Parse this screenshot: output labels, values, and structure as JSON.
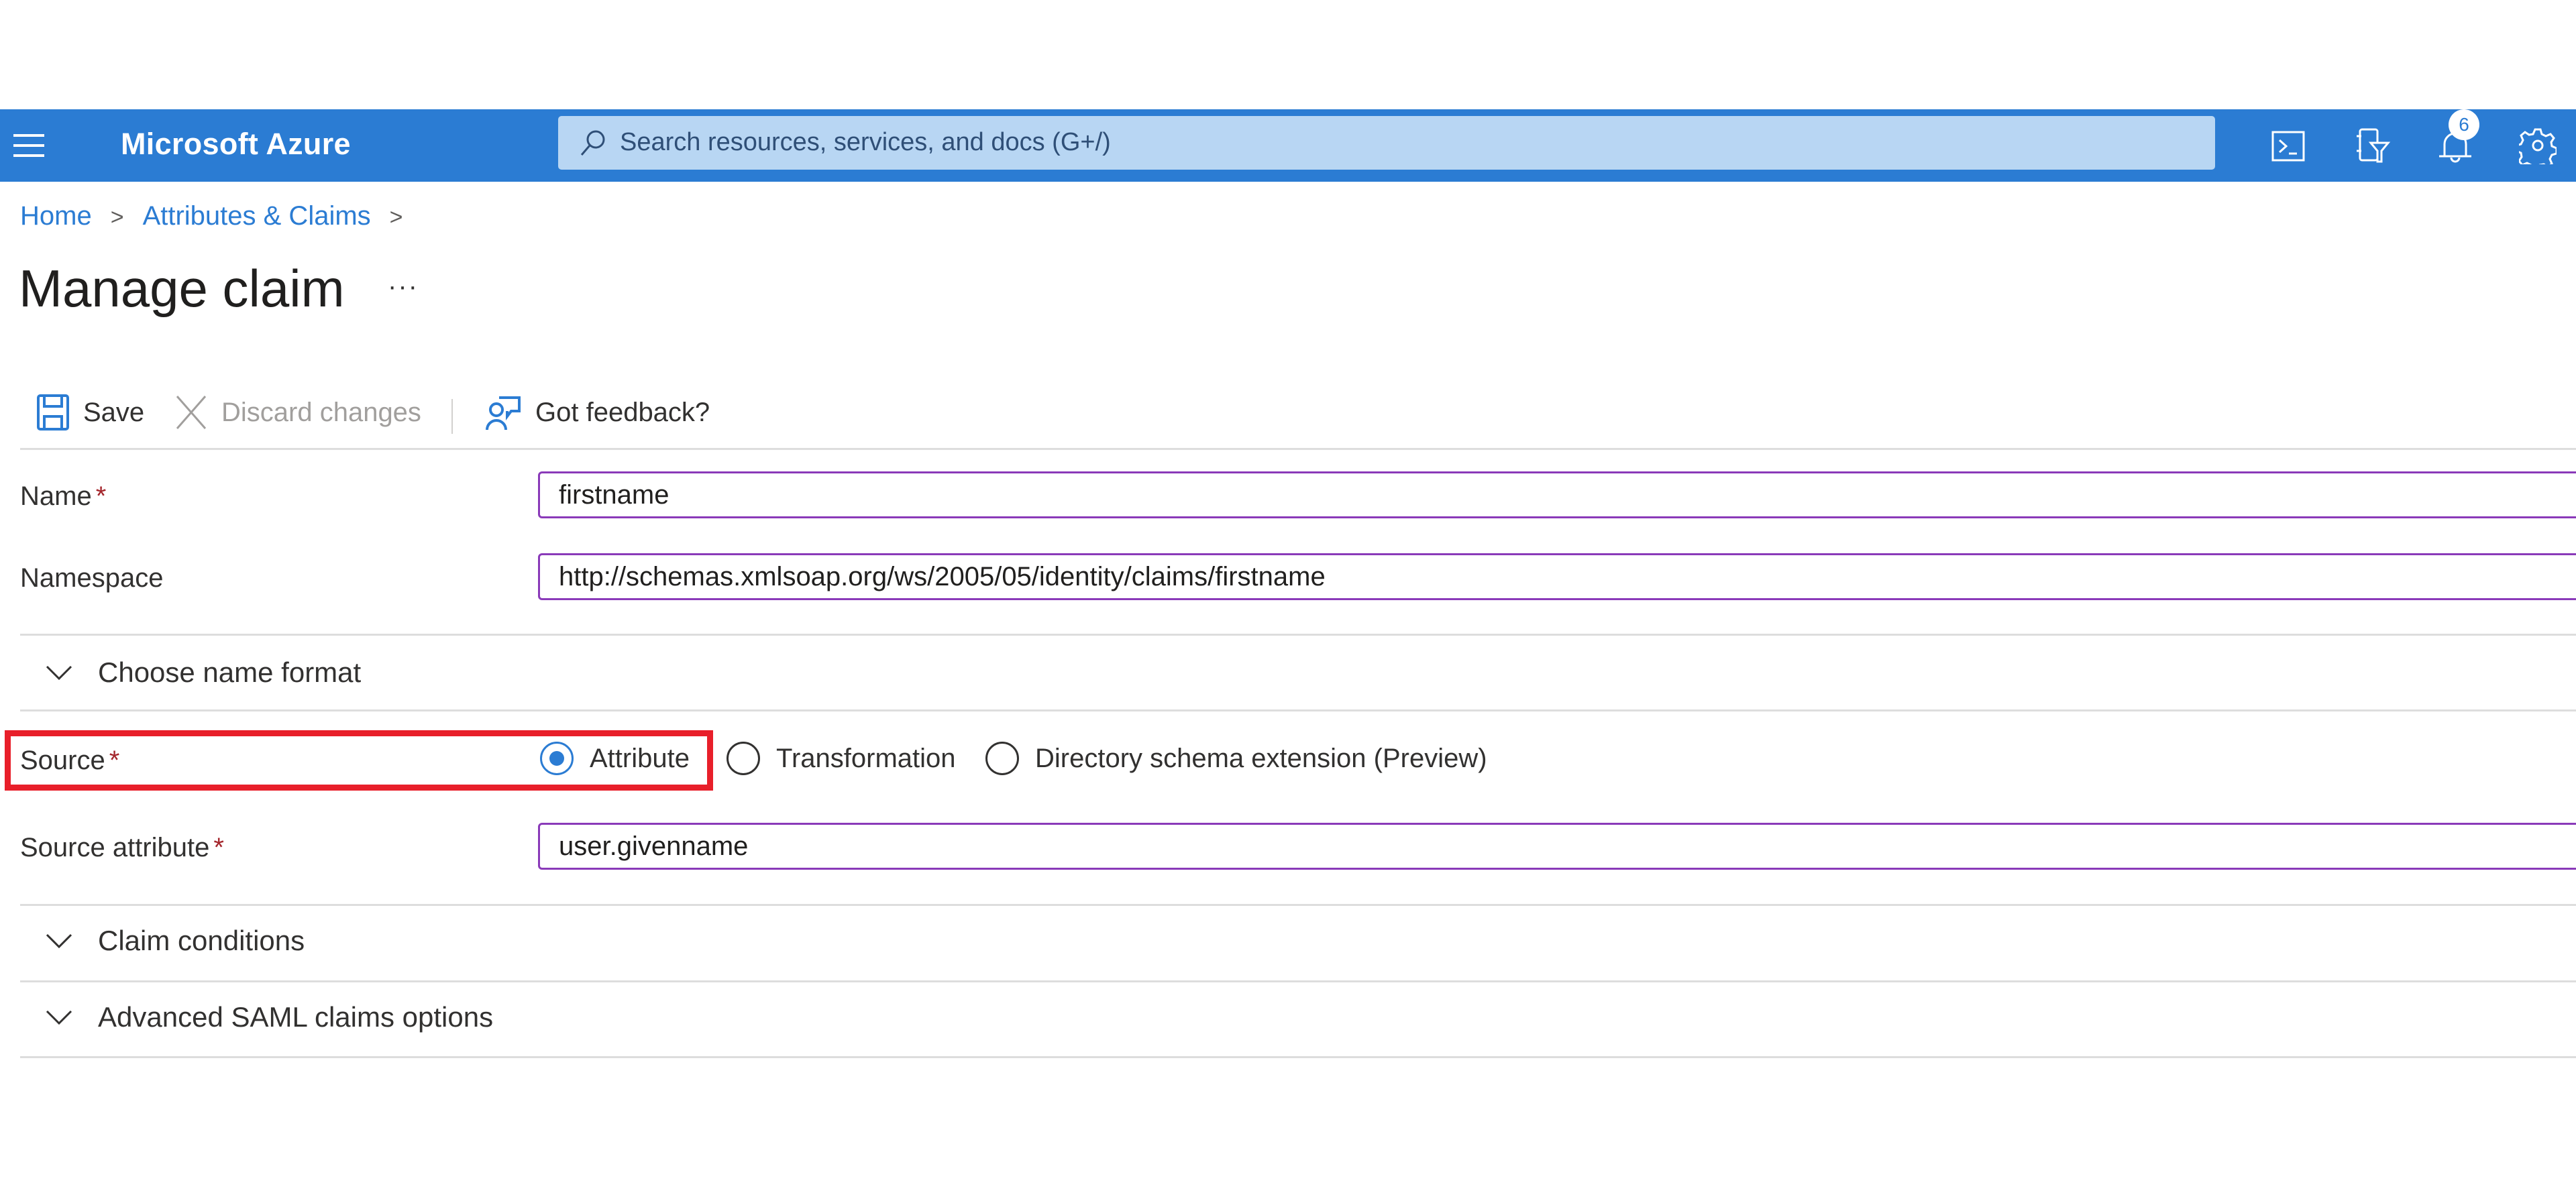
{
  "topbar": {
    "brand": "Microsoft Azure",
    "search_placeholder": "Search resources, services, and docs (G+/)",
    "notifications_count": "6",
    "icons": [
      "hamburger-menu-icon",
      "cloud-shell-icon",
      "directory-filter-icon",
      "bell-icon",
      "gear-icon"
    ]
  },
  "breadcrumb": {
    "items": [
      "Home",
      "Attributes & Claims"
    ]
  },
  "page": {
    "title": "Manage claim",
    "more_label": "···"
  },
  "toolbar": {
    "save_label": "Save",
    "discard_label": "Discard changes",
    "feedback_label": "Got feedback?"
  },
  "form": {
    "name_label": "Name",
    "name_value": "firstname",
    "namespace_label": "Namespace",
    "namespace_value": "http://schemas.xmlsoap.org/ws/2005/05/identity/claims/firstname",
    "name_format_section": "Choose name format",
    "source_label": "Source",
    "source_options": [
      {
        "label": "Attribute",
        "checked": true
      },
      {
        "label": "Transformation",
        "checked": false
      },
      {
        "label": "Directory schema extension (Preview)",
        "checked": false
      }
    ],
    "source_attribute_label": "Source attribute",
    "source_attribute_value": "user.givenname",
    "required_marker": "*",
    "claim_conditions_section": "Claim conditions",
    "advanced_section": "Advanced SAML claims options"
  },
  "colors": {
    "brand_blue": "#2b7cd3",
    "input_border": "#8a3ab9",
    "highlight_red": "#e81f2a",
    "required_red": "#a4262c"
  }
}
